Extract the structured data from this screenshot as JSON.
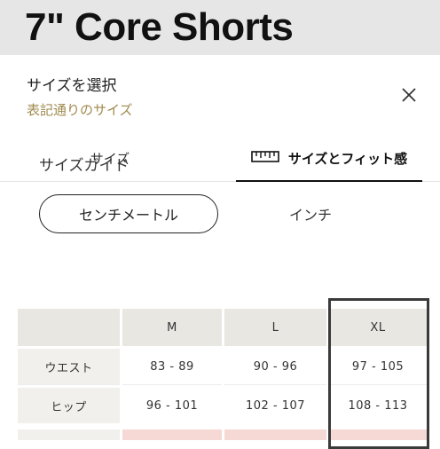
{
  "product": {
    "title": "7\" Core Shorts"
  },
  "sheet": {
    "title": "サイズを選択",
    "subtitle": "表記通りのサイズ",
    "close_icon": "close-icon"
  },
  "tabs": [
    {
      "label": "サイズ",
      "active": false
    },
    {
      "label": "サイズとフィット感",
      "active": true,
      "icon": "ruler-icon"
    }
  ],
  "guide": {
    "title": "サイズガイド",
    "units": [
      {
        "label": "センチメートル",
        "selected": true
      },
      {
        "label": "インチ",
        "selected": false
      }
    ]
  },
  "size_table": {
    "headers": [
      "",
      "M",
      "L",
      "XL"
    ],
    "rows": [
      {
        "label": "ウエスト",
        "values": [
          "83 - 89",
          "90 - 96",
          "97 - 105"
        ]
      },
      {
        "label": "ヒップ",
        "values": [
          "96 - 101",
          "102 - 107",
          "108 - 113"
        ]
      }
    ]
  },
  "colors": {
    "accent_text": "#a08a4e",
    "header_bg": "#e9e7e2",
    "label_bg": "#f2f0ec"
  }
}
